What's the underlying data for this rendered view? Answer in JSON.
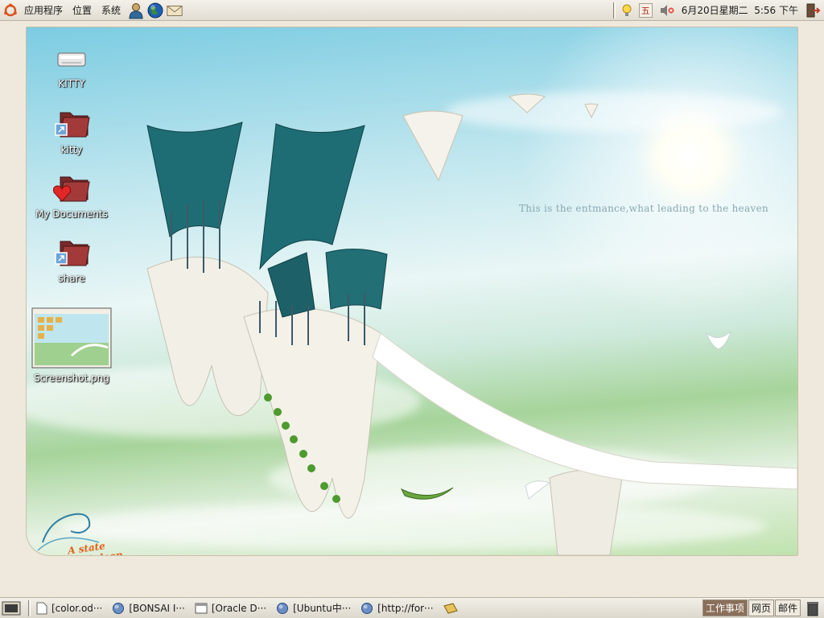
{
  "top_panel": {
    "menus": [
      "应用程序",
      "位置",
      "系统"
    ],
    "launchers": [
      "people-icon",
      "web-browser-icon",
      "mail-icon"
    ],
    "tray": {
      "weekday_badge": "五",
      "datetime": "6月20日星期二  5:56 下午"
    }
  },
  "desktop": {
    "icons": [
      {
        "label": "KITTY",
        "icon": "drive-icon"
      },
      {
        "label": "kitty",
        "icon": "folder-link-icon"
      },
      {
        "label": "My Documents",
        "icon": "folder-heart-icon"
      },
      {
        "label": "share",
        "icon": "folder-link-icon"
      },
      {
        "label": "Screenshot.png",
        "icon": "image-thumbnail-icon"
      }
    ],
    "wallpaper_caption": "This is the entmance,what leading to the heaven",
    "wallpaper_logo_line1": "A state",
    "wallpaper_logo_line2": "of sleep"
  },
  "bottom_panel": {
    "tasks": [
      {
        "label": "[color.od···",
        "icon": "document-icon"
      },
      {
        "label": "[BONSAI I···",
        "icon": "globe-icon"
      },
      {
        "label": "[Oracle D···",
        "icon": "window-icon"
      },
      {
        "label": "[Ubuntu中···",
        "icon": "globe-icon"
      },
      {
        "label": "[http://for···",
        "icon": "globe-icon"
      }
    ],
    "workspaces": [
      "工作事项",
      "网页",
      "邮件"
    ]
  },
  "colors": {
    "panel": "#e8e4da",
    "active_workspace": "#8a6f5a"
  }
}
